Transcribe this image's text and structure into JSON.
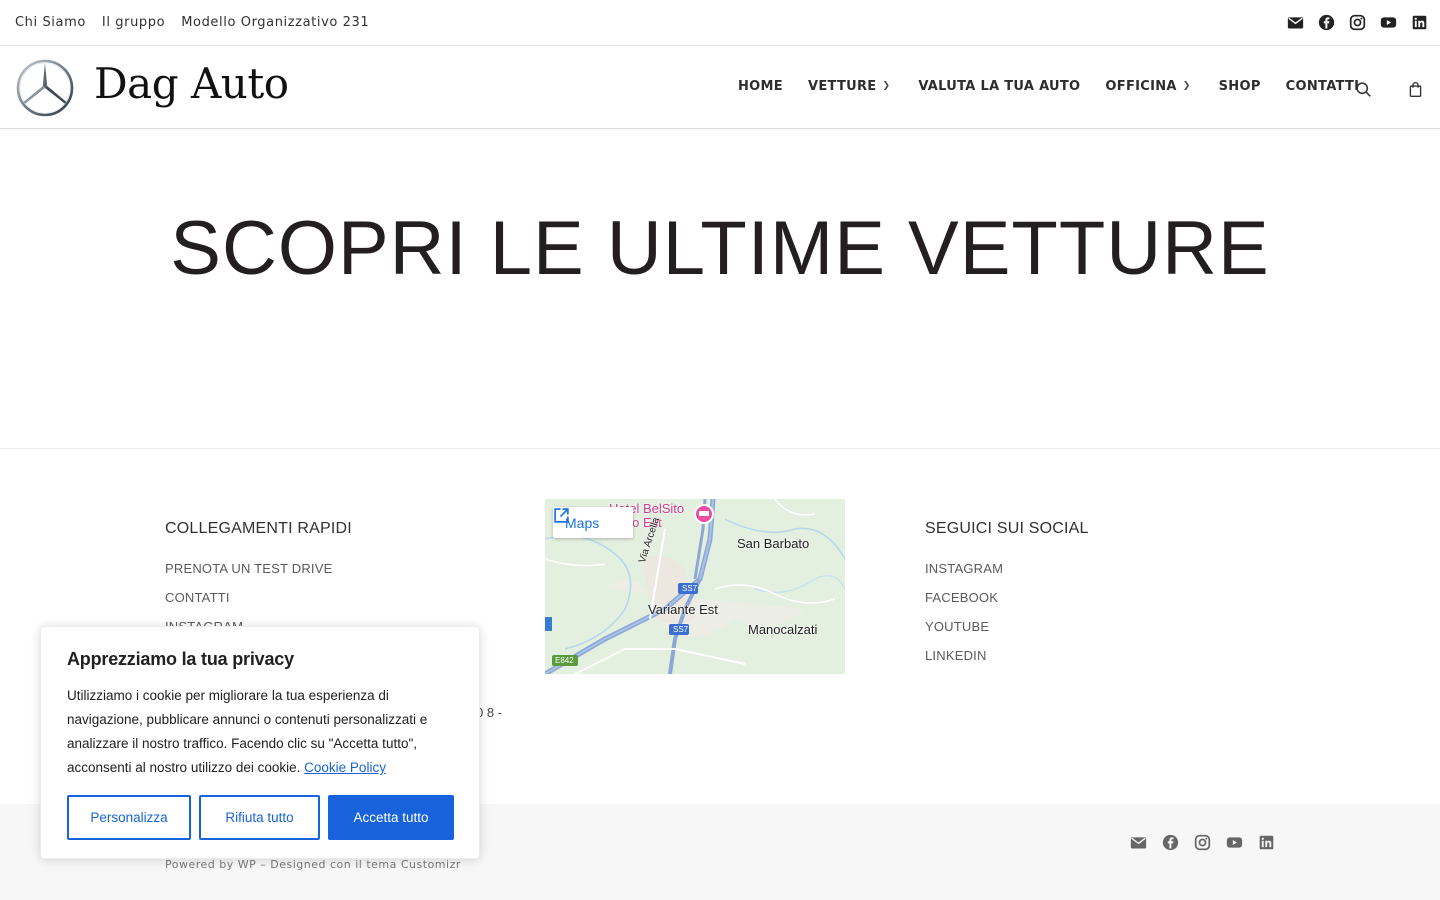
{
  "topbar": {
    "links": [
      "Chi Siamo",
      "Il gruppo",
      "Modello Organizzativo 231"
    ],
    "social_icons": [
      "envelope-icon",
      "facebook-icon",
      "instagram-icon",
      "youtube-icon",
      "linkedin-icon"
    ]
  },
  "header": {
    "brand": "Dag Auto",
    "nav": {
      "home": "HOME",
      "vetture": "VETTURE",
      "valuta": "VALUTA LA TUA AUTO",
      "officina": "OFFICINA",
      "shop": "SHOP",
      "contatti": "CONTATTI"
    }
  },
  "hero": {
    "title": "SCOPRI LE ULTIME VETTURE"
  },
  "footer": {
    "quick_links": {
      "title": "COLLEGAMENTI RAPIDI",
      "items": [
        "PRENOTA UN TEST DRIVE",
        "CONTATTI",
        "INSTAGRAM"
      ]
    },
    "address_fragment": "0 8 -",
    "map": {
      "button": "Maps",
      "labels": {
        "hotel": "Hotel BelSito",
        "hotel2": "ellino Est",
        "via": "Via Arcella",
        "san_barbato": "San Barbato",
        "variante": "Variante Est",
        "manocalzati": "Manocalzati",
        "ss7a": "SS7",
        "ss7b": "SS7",
        "e842": "E842"
      }
    },
    "social": {
      "title": "SEGUICI SUI SOCIAL",
      "items": [
        "INSTAGRAM",
        "FACEBOOK",
        "YOUTUBE",
        "LINKEDIN"
      ]
    },
    "powered": "Powered by WP – Designed con il tema Customizr"
  },
  "cookie": {
    "title": "Apprezziamo la tua privacy",
    "text": "Utilizziamo i cookie per migliorare la tua esperienza di navigazione, pubblicare annunci o contenuti personalizzati e analizzare il nostro traffico. Facendo clic su \"Accetta tutto\", acconsenti al nostro utilizzo dei cookie.",
    "policy_link": "Cookie Policy",
    "buttons": {
      "customize": "Personalizza",
      "reject": "Rifiuta tutto",
      "accept": "Accetta tutto"
    },
    "accent_color": "#1863dc"
  }
}
